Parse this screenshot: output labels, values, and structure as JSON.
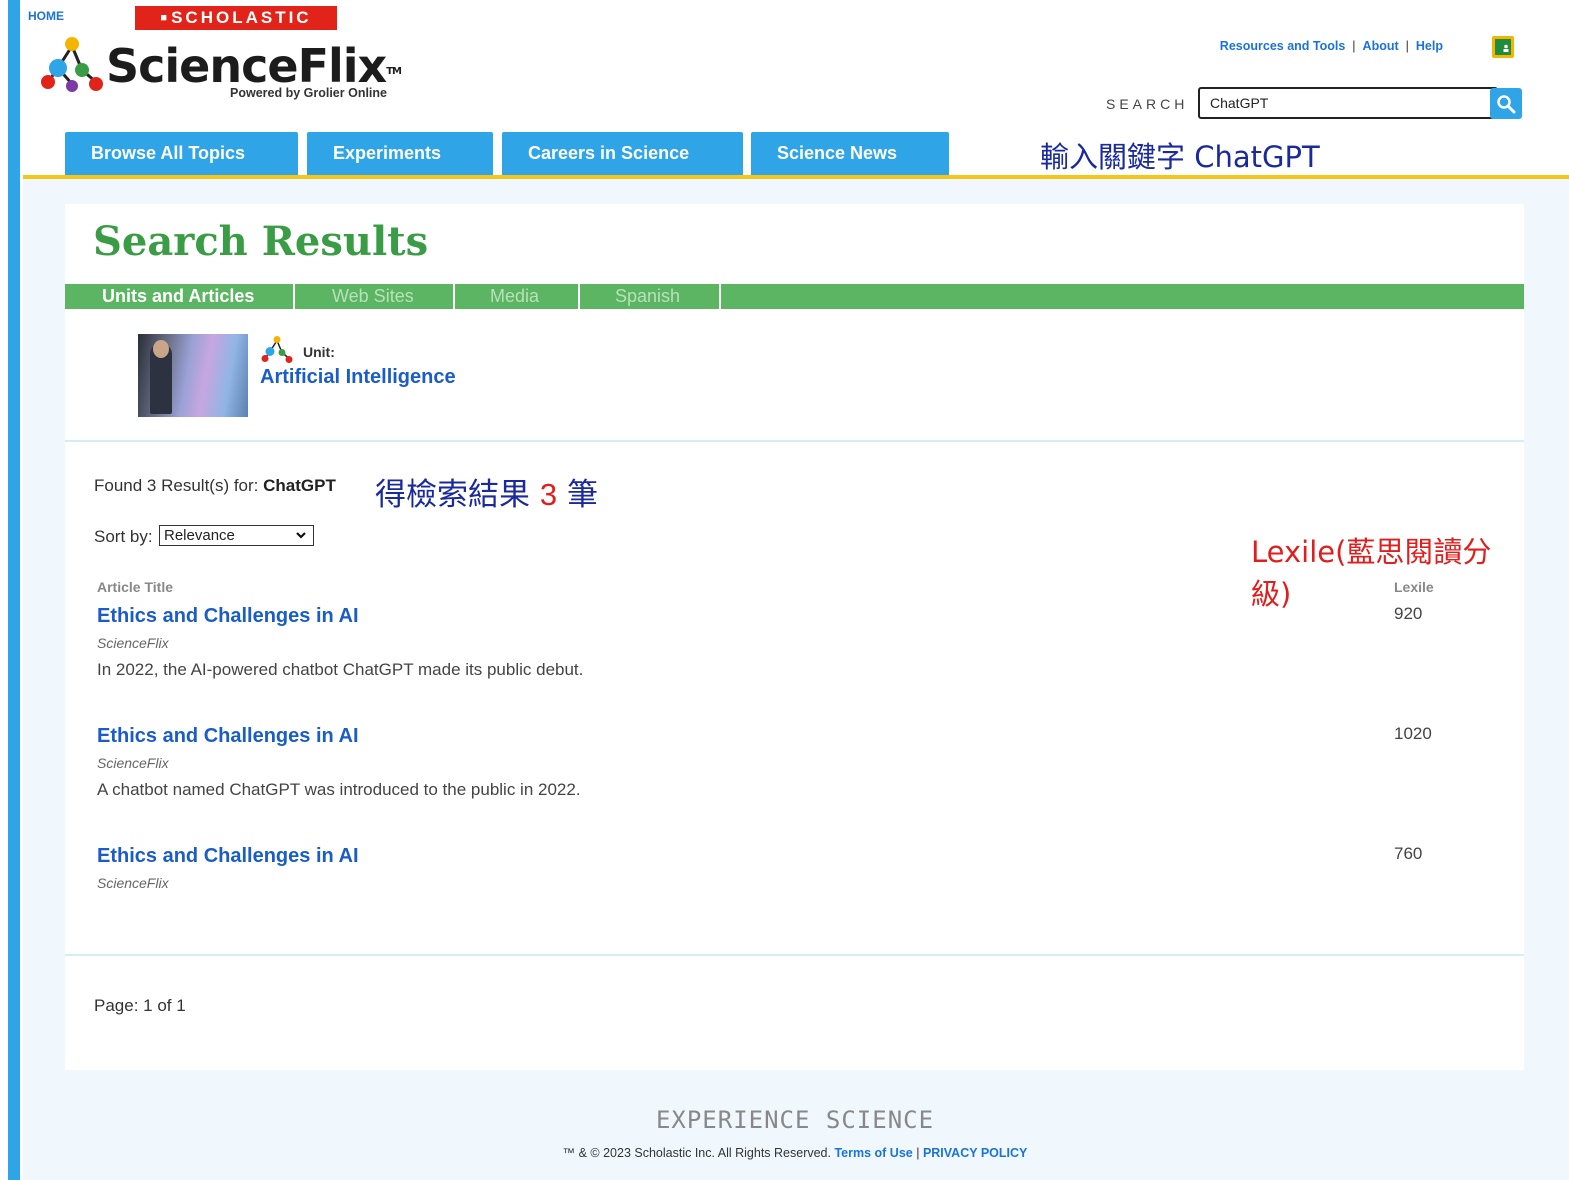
{
  "header": {
    "home_label": "HOME",
    "scholastic_label": "SCHOLASTIC",
    "logo_name": "ScienceFlix",
    "logo_tm": "TM",
    "logo_tagline": "Powered by Grolier Online",
    "top_links": [
      "Resources and Tools",
      "About",
      "Help"
    ],
    "search_label": "SEARCH",
    "search_value": "ChatGPT",
    "classroom_icon": "google-classroom-icon",
    "search_icon": "magnifier-icon"
  },
  "nav": {
    "tabs": [
      "Browse All Topics",
      "Experiments",
      "Careers in Science",
      "Science News"
    ]
  },
  "annotations": {
    "keyword": "輸入關鍵字 ChatGPT",
    "count_prefix": "得檢索結果 ",
    "count_num": "3",
    "count_suffix": " 筆",
    "lexile": "Lexile(藍思閱讀分級)"
  },
  "main": {
    "title": "Search Results",
    "subtabs": [
      "Units and Articles",
      "Web Sites",
      "Media",
      "Spanish"
    ],
    "active_subtab": "Units and Articles",
    "unit": {
      "label": "Unit:",
      "name": "Artificial Intelligence"
    },
    "found_prefix": "Found 3 Result(s) for: ",
    "found_query": "ChatGPT",
    "sort_label": "Sort by:",
    "sort_value": "Relevance",
    "columns": {
      "title": "Article Title",
      "lexile": "Lexile"
    },
    "results": [
      {
        "title": "Ethics and Challenges in AI",
        "source": "ScienceFlix",
        "snippet": "In 2022, the AI-powered chatbot ChatGPT made its public debut.",
        "lexile": "920"
      },
      {
        "title": "Ethics and Challenges in AI",
        "source": "ScienceFlix",
        "snippet": "A chatbot named ChatGPT was introduced to the public in 2022.",
        "lexile": "1020"
      },
      {
        "title": "Ethics and Challenges in AI",
        "source": "ScienceFlix",
        "snippet": "",
        "lexile": "760"
      }
    ],
    "page_info": "Page: 1 of 1"
  },
  "footer": {
    "experience": "EXPERIENCE SCIENCE",
    "copyright": "™ & © 2023 Scholastic Inc. All Rights Reserved. ",
    "terms": "Terms of Use",
    "sep": " | ",
    "privacy": "PRIVACY POLICY"
  },
  "colors": {
    "brand_blue": "#2fa4e7",
    "title_green": "#3a9d46",
    "subtab_green": "#5cb562",
    "link_blue": "#1a5dc8",
    "scholastic_red": "#e2231a",
    "accent_yellow": "#f5c518"
  }
}
